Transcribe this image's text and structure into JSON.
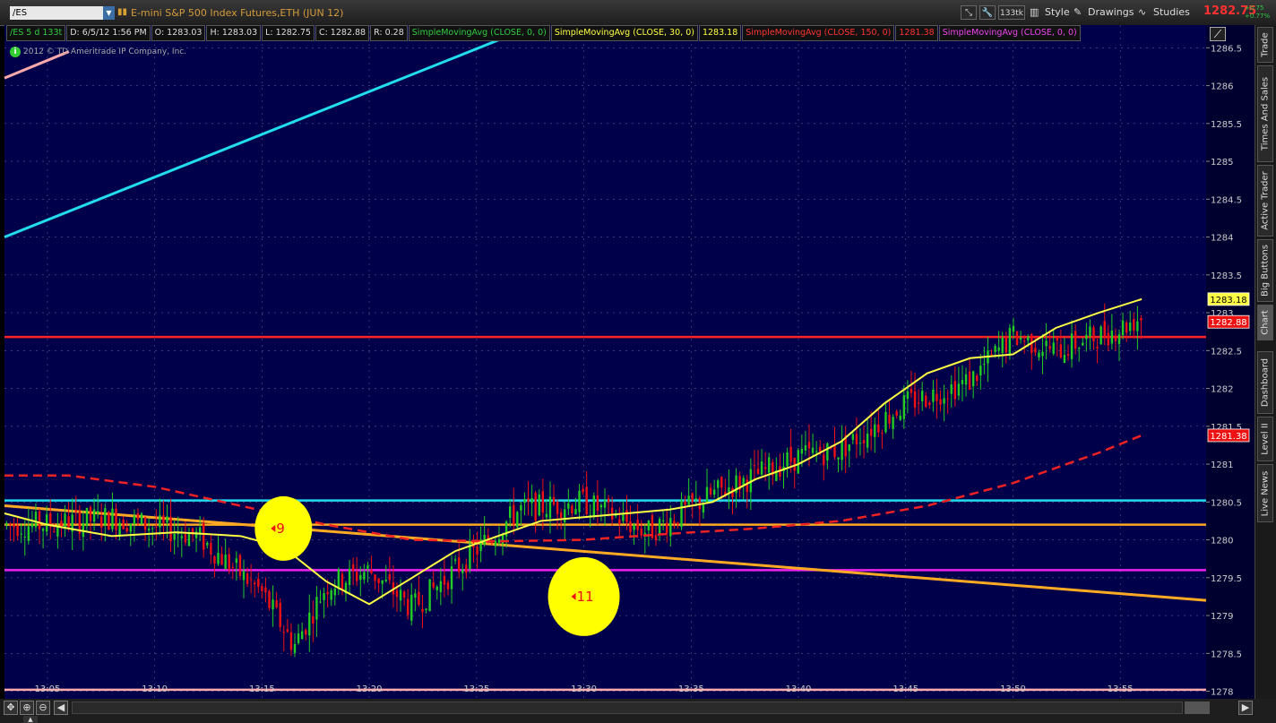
{
  "toolbar": {
    "symbol": "/ES",
    "description": "E-mini S&P 500 Index Futures,ETH (JUN 12)",
    "tick_button": "133tk",
    "style_label": "Style",
    "drawings_label": "Drawings",
    "studies_label": "Studies",
    "last_price": "1282.75",
    "change_abs": "+0.75",
    "change_pct": "+0.77%"
  },
  "info_bar": {
    "spec": "/ES 5 d 133t",
    "date": "D: 6/5/12 1:56 PM",
    "open": "O: 1283.03",
    "high": "H: 1283.03",
    "low": "L: 1282.75",
    "close": "C: 1282.88",
    "range": "R: 0.28",
    "sma1": "SimpleMovingAvg (CLOSE, 0, 0)",
    "sma30": "SimpleMovingAvg (CLOSE, 30, 0)",
    "sma30_value": "1283.18",
    "sma150": "SimpleMovingAvg (CLOSE, 150, 0)",
    "sma150_value": "1281.38",
    "sma_magenta": "SimpleMovingAvg (CLOSE, 0, 0)"
  },
  "copyright": "2012 © TD Ameritrade IP Company, Inc.",
  "sidebar": {
    "tabs": [
      "Trade",
      "Times And Sales",
      "Active Trader",
      "Big Buttons",
      "Chart",
      "Dashboard",
      "Level II",
      "Live News"
    ]
  },
  "colors": {
    "background": "#00004a",
    "up": "#22cc22",
    "down": "#ee1111",
    "sma30": "#ffff44",
    "sma150": "#ee2222",
    "cyan": "#22ddee",
    "orange": "#ffaa22",
    "magenta": "#ee22ee",
    "red_line": "#ff2222",
    "pink": "#ffaaaa",
    "marker": "#ffff00"
  },
  "chart_data": {
    "type": "candlestick",
    "ylim": [
      1277.9,
      1286.8
    ],
    "y_ticks": [
      1278,
      1278.5,
      1279,
      1279.5,
      1280,
      1280.5,
      1281,
      1281.5,
      1282,
      1282.5,
      1283,
      1283.5,
      1284,
      1284.5,
      1285,
      1285.5,
      1286,
      1286.5
    ],
    "y_tick_labels": [
      "1278",
      "1278.5",
      "1279",
      "1279.5",
      "1280",
      "1280.5",
      "1281",
      "1281.5",
      "1282",
      "1282.5",
      "1283",
      "1283.5",
      "1284",
      "1284.5",
      "1285",
      "1285.5",
      "1286",
      "1286.5"
    ],
    "x_range": [
      "13:03",
      "13:59"
    ],
    "x_ticks": [
      "13:05",
      "13:10",
      "13:15",
      "13:20",
      "13:25",
      "13:30",
      "13:35",
      "13:40",
      "13:45",
      "13:50",
      "13:55"
    ],
    "x_tick_labels": [
      "13:05",
      "13:10",
      "13:15",
      "13:20",
      "13:25",
      "13:30",
      "13:35",
      "13:40",
      "13:45",
      "13:50",
      "13:55"
    ],
    "price_tags": [
      {
        "label": "1283.18",
        "value": 1283.18,
        "color": "#ffff44",
        "text_color": "#000000"
      },
      {
        "label": "1282.88",
        "value": 1282.88,
        "color": "#ee1111",
        "text_color": "#ffffff"
      },
      {
        "label": "1281.38",
        "value": 1281.38,
        "color": "#ee1111",
        "text_color": "#ffffff"
      }
    ],
    "horizontal_lines": [
      {
        "name": "red level",
        "value": 1282.68,
        "color": "#ff2222"
      },
      {
        "name": "cyan level",
        "value": 1280.52,
        "color": "#22ddee"
      },
      {
        "name": "orange level",
        "value": 1280.2,
        "color": "#ffaa22"
      },
      {
        "name": "magenta level",
        "value": 1279.6,
        "color": "#ee22ee"
      },
      {
        "name": "pink level",
        "value": 1278.02,
        "color": "#ffaaaa"
      }
    ],
    "trend_lines": [
      {
        "name": "cyan trendline",
        "x": [
          "13:03",
          "13:26"
        ],
        "y": [
          1284.0,
          1286.6
        ],
        "color": "#22ddee"
      },
      {
        "name": "pink trendline",
        "x": [
          "13:03",
          "13:06"
        ],
        "y": [
          1286.1,
          1286.45
        ],
        "color": "#ffaaaa"
      },
      {
        "name": "orange trendline",
        "x": [
          "13:03",
          "13:59"
        ],
        "y": [
          1280.45,
          1279.2
        ],
        "color": "#ffaa22"
      }
    ],
    "markers": [
      {
        "label": "9",
        "x": "13:16",
        "y": 1280.15
      },
      {
        "label": "11",
        "x": "13:30",
        "y": 1279.25
      }
    ],
    "sma30": {
      "x": [
        "13:03",
        "13:05",
        "13:08",
        "13:11",
        "13:14",
        "13:16",
        "13:18",
        "13:20",
        "13:22",
        "13:24",
        "13:26",
        "13:28",
        "13:30",
        "13:32",
        "13:34",
        "13:36",
        "13:38",
        "13:40",
        "13:42",
        "13:44",
        "13:46",
        "13:48",
        "13:50",
        "13:52",
        "13:54",
        "13:56"
      ],
      "y": [
        1280.35,
        1280.2,
        1280.05,
        1280.1,
        1280.05,
        1279.9,
        1279.45,
        1279.15,
        1279.5,
        1279.85,
        1280.05,
        1280.25,
        1280.3,
        1280.35,
        1280.4,
        1280.5,
        1280.8,
        1281.0,
        1281.3,
        1281.8,
        1282.2,
        1282.4,
        1282.45,
        1282.8,
        1283.0,
        1283.18
      ]
    },
    "sma150": {
      "x": [
        "13:03",
        "13:06",
        "13:10",
        "13:14",
        "13:18",
        "13:22",
        "13:26",
        "13:30",
        "13:34",
        "13:38",
        "13:42",
        "13:46",
        "13:50",
        "13:54",
        "13:56"
      ],
      "y": [
        1280.85,
        1280.85,
        1280.7,
        1280.45,
        1280.2,
        1280.0,
        1279.98,
        1280.0,
        1280.08,
        1280.15,
        1280.25,
        1280.45,
        1280.75,
        1281.15,
        1281.38
      ]
    },
    "candles_summary": {
      "first_time": "13:03",
      "last_time": "13:56",
      "last_close": 1282.88,
      "session_low": 1278.3,
      "session_high": 1284.0
    }
  }
}
